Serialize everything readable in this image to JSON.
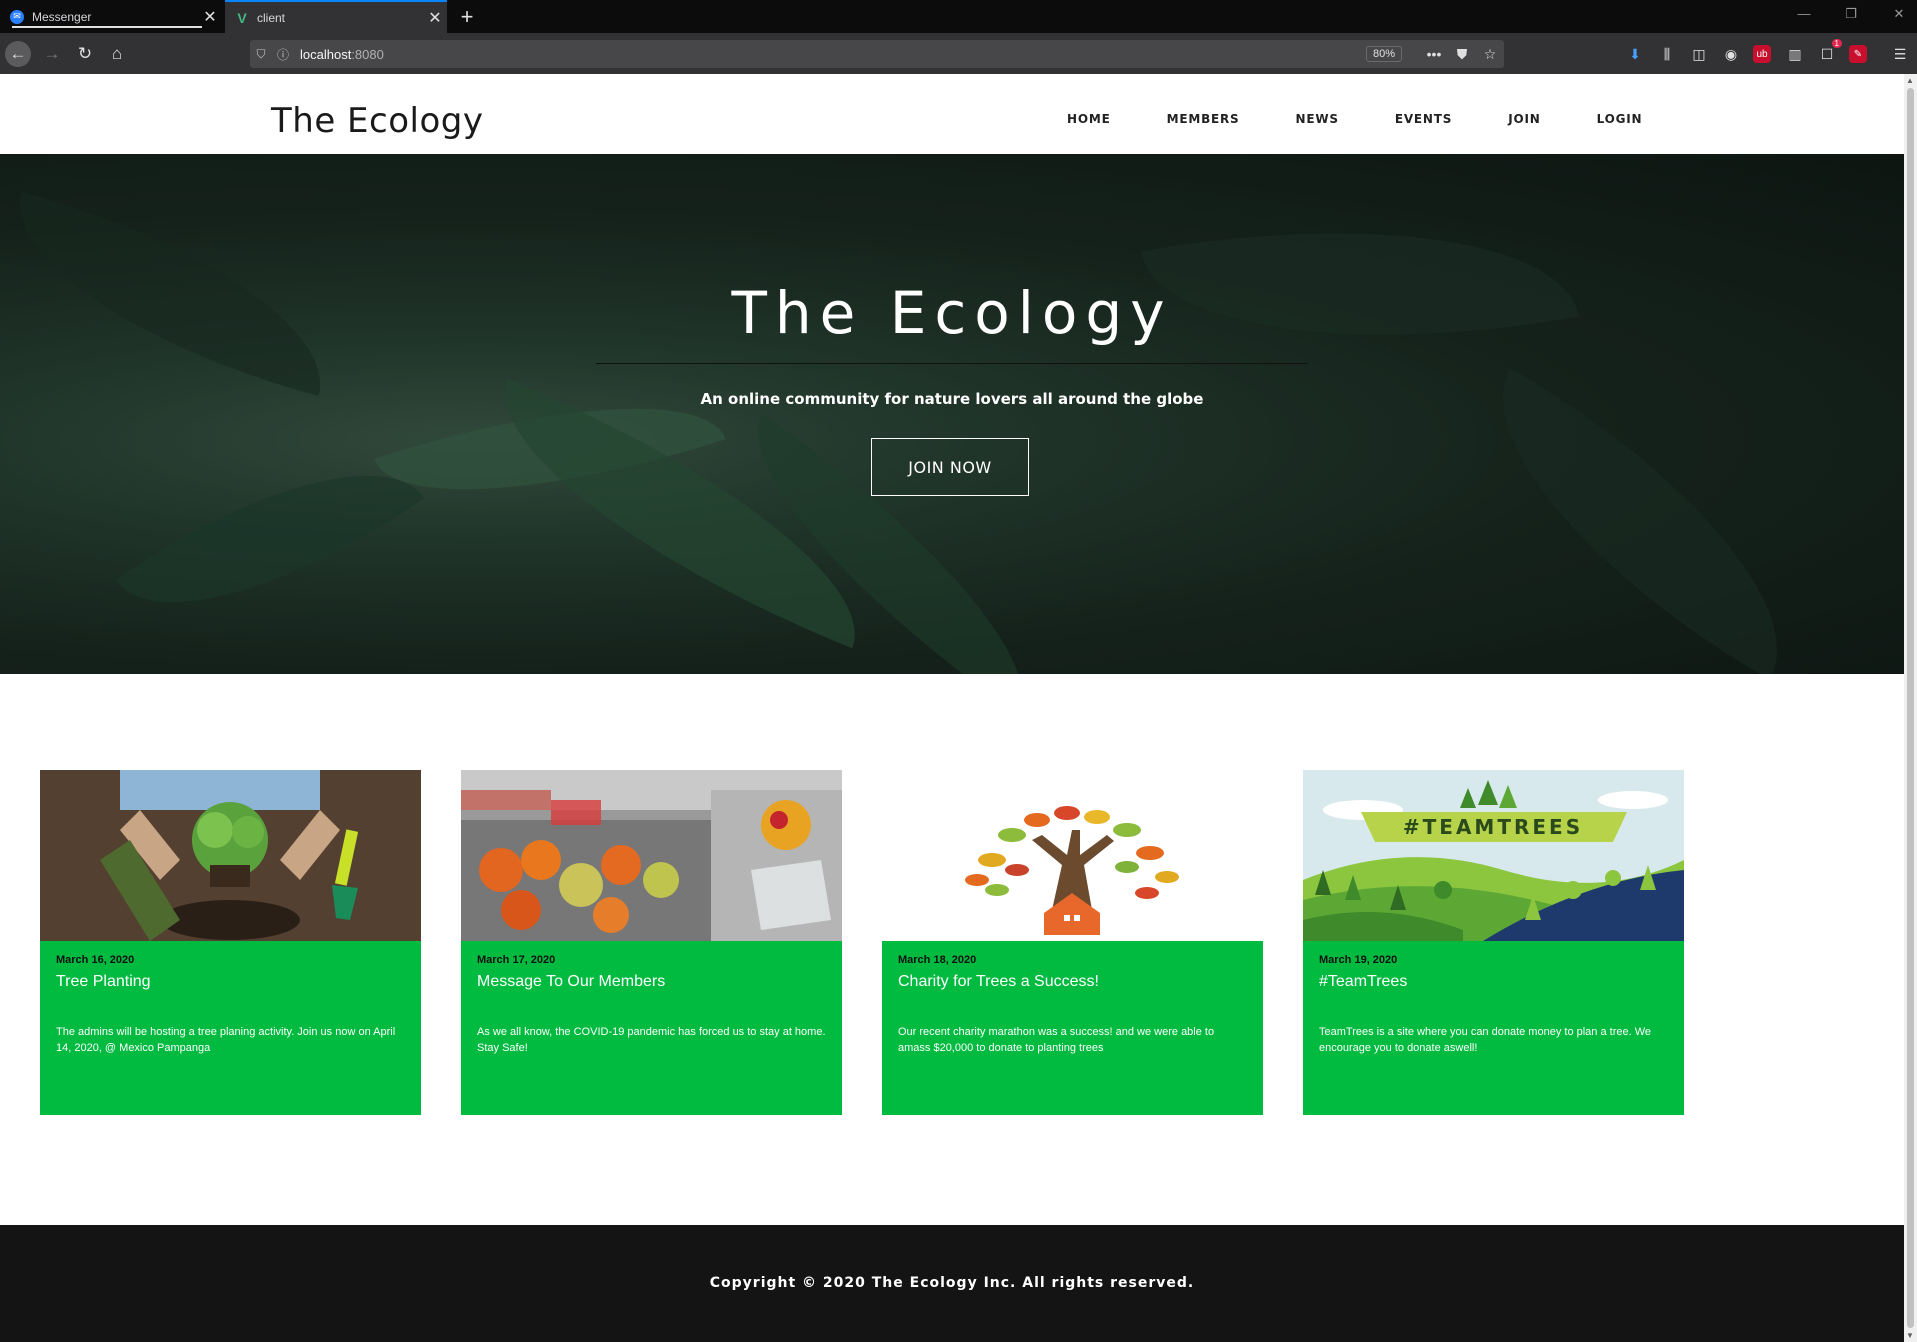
{
  "browser": {
    "tabs": [
      {
        "title": "Messenger",
        "icon": "messenger-icon"
      },
      {
        "title": "client",
        "icon": "vue-icon"
      }
    ],
    "url_host": "localhost",
    "url_port": ":8080",
    "zoom": "80%",
    "badge_count": "1",
    "accent": "#0a84ff"
  },
  "site": {
    "brand": "The Ecology",
    "menu": [
      "HOME",
      "MEMBERS",
      "NEWS",
      "EVENTS",
      "JOIN",
      "LOGIN"
    ]
  },
  "hero": {
    "title": "The Ecology",
    "subtitle": "An online community for nature lovers all around the globe",
    "button": "JOIN NOW"
  },
  "cards": [
    {
      "date": "March 16, 2020",
      "title": "Tree Planting",
      "body": "The admins will be hosting a tree planing activity. Join us now on April 14, 2020, @ Mexico Pampanga",
      "image": "hands-planting-seedling"
    },
    {
      "date": "March 17, 2020",
      "title": "Message To Our Members",
      "body": "As we all know, the COVID-19 pandemic has forced us to stay at home. Stay Safe!",
      "image": "food-trays"
    },
    {
      "date": "March 18, 2020",
      "title": "Charity for Trees a Success!",
      "body": "Our recent charity marathon was a success! and we were able to amass $20,000 to donate to planting trees",
      "image": "tree-charity-logo"
    },
    {
      "date": "March 19, 2020",
      "title": "#TeamTrees",
      "body": "TeamTrees is a site where you can donate money to plan a tree. We encourage you to donate aswell!",
      "image": "teamtrees-banner",
      "banner_text": "#TEAMTREES"
    }
  ],
  "footer": {
    "copyright": "Copyright © 2020 The Ecology Inc. All rights reserved."
  },
  "colors": {
    "card_green": "#00bb3f",
    "footer_bg": "#141414",
    "hero_dark": "#1b2c23"
  }
}
